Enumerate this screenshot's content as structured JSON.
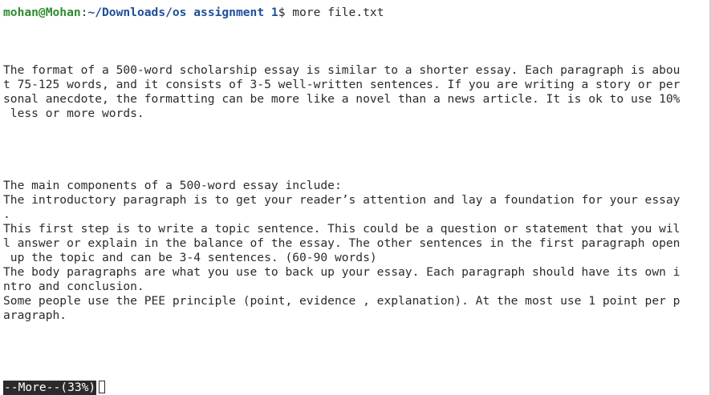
{
  "prompt": {
    "user_host": "mohan@Mohan",
    "colon": ":",
    "path": "~/Downloads/os assignment 1",
    "dollar": "$",
    "command": " more file.txt"
  },
  "output_lines": [
    "The format of a 500-word scholarship essay is similar to a shorter essay. Each paragraph is abou",
    "t 75-125 words, and it consists of 3-5 well-written sentences. If you are writing a story or per",
    "sonal anecdote, the formatting can be more like a novel than a news article. It is ok to use 10%",
    " less or more words.",
    "The main components of a 500-word essay include:",
    "The introductory paragraph is to get your reader’s attention and lay a foundation for your essay",
    ".",
    "This first step is to write a topic sentence. This could be a question or statement that you wil",
    "l answer or explain in the balance of the essay. The other sentences in the first paragraph open",
    " up the topic and can be 3-4 sentences. (60-90 words)",
    "The body paragraphs are what you use to back up your essay. Each paragraph should have its own i",
    "ntro and conclusion.",
    "Some people use the PEE principle (point, evidence , explanation). At the most use 1 point per p",
    "aragraph."
  ],
  "pager_status": "--More--(33%)"
}
